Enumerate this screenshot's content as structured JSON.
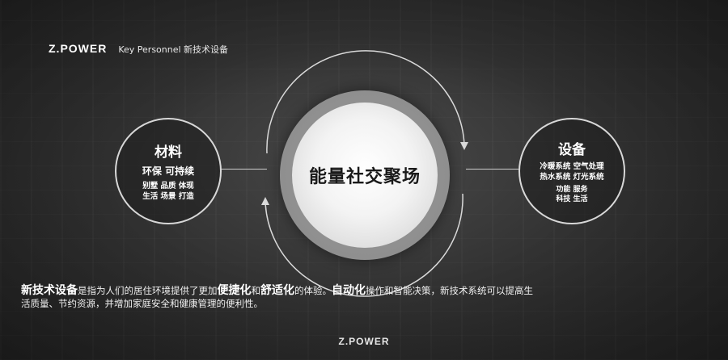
{
  "header": {
    "brand": "Z.POWER",
    "subtitle": "Key Personnel 新技术设备"
  },
  "left_circle": {
    "title": "材料",
    "subtitle": "环保  可持续",
    "lines": [
      "别墅 品质 体现",
      "生活 场景 打造"
    ]
  },
  "center": {
    "title": "能量社交聚场"
  },
  "right_circle": {
    "title": "设备",
    "lines": [
      "冷暖系统  空气处理",
      "热水系统  灯光系统"
    ],
    "lines_small": [
      "功能  服务",
      "科技  生活"
    ]
  },
  "description": {
    "p1_bold": "新技术设备",
    "p2": "是指为人们的居住环境提供了更加",
    "p3_bold": "便捷化",
    "p4": "和",
    "p5_bold": "舒适化",
    "p6": "的体验。",
    "p7_bold": "自动化",
    "p8": "操作和智能决策，新技术系统可以提高生活质量、节约资源，并增加家庭安全和健康管理的便利性。"
  },
  "footer": {
    "brand": "Z.POWER"
  }
}
